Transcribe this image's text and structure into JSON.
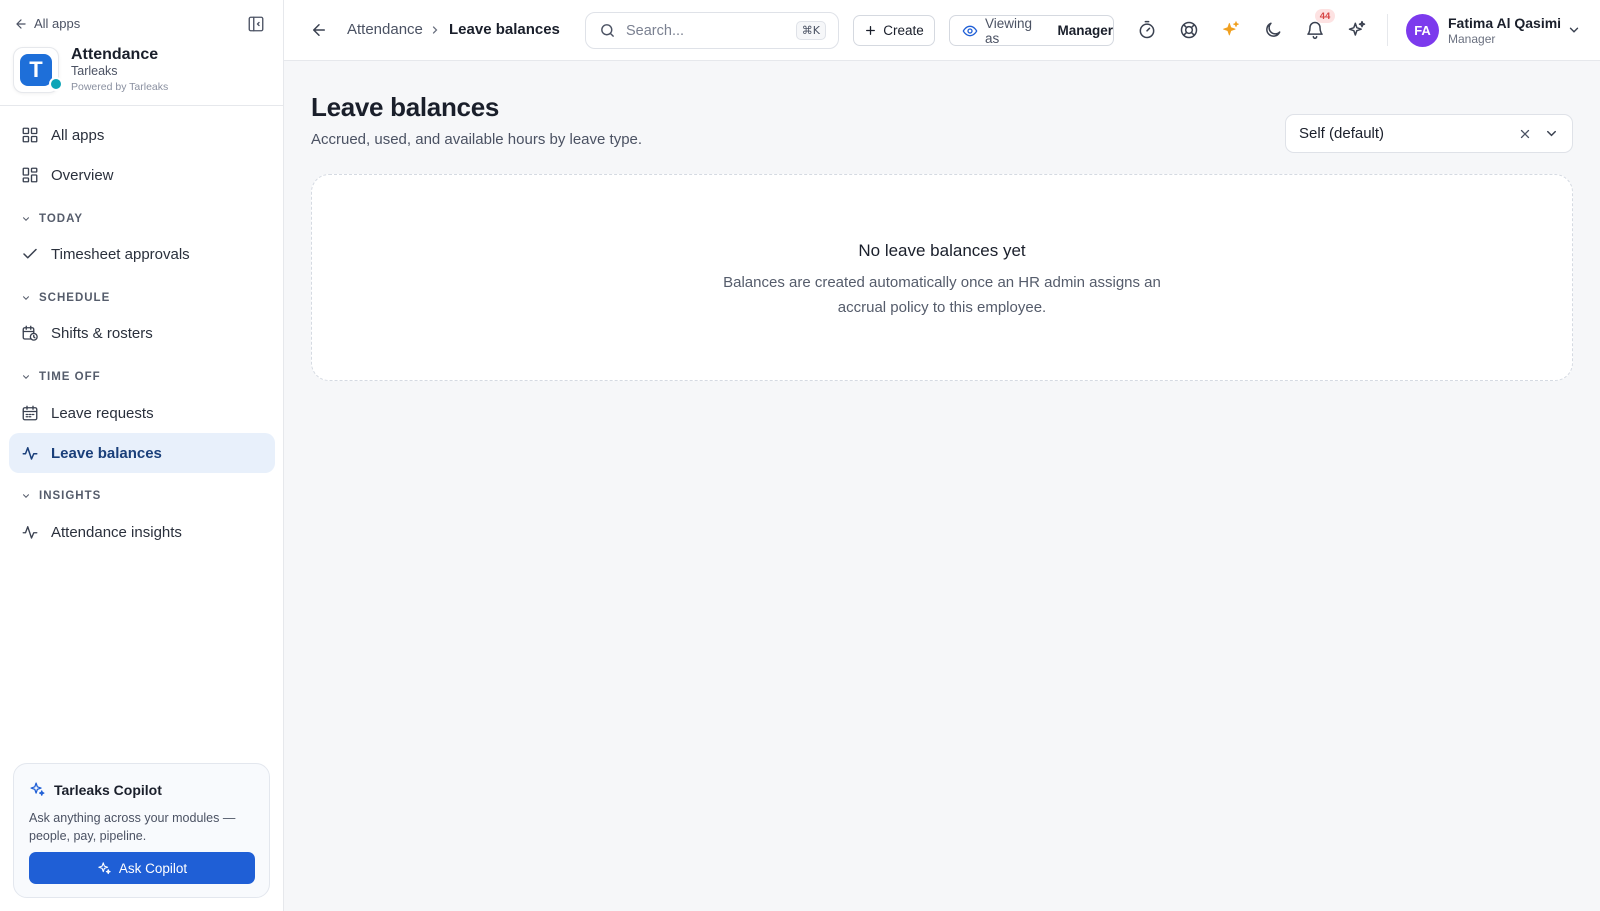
{
  "sidebar": {
    "back_label": "All apps",
    "app": {
      "title": "Attendance",
      "org": "Tarleaks",
      "powered": "Powered by Tarleaks",
      "logo_letter": "T"
    },
    "items": {
      "all_apps": "All apps",
      "overview": "Overview",
      "timesheet_approvals": "Timesheet approvals",
      "shifts_rosters": "Shifts & rosters",
      "leave_requests": "Leave requests",
      "leave_balances": "Leave balances",
      "attendance_insights": "Attendance insights"
    },
    "sections": {
      "today": "TODAY",
      "schedule": "SCHEDULE",
      "time_off": "TIME OFF",
      "insights": "INSIGHTS"
    },
    "active_item": "Leave balances",
    "copilot": {
      "title": "Tarleaks Copilot",
      "description": "Ask anything across your modules — people, pay, pipeline.",
      "button": "Ask Copilot"
    }
  },
  "topbar": {
    "breadcrumb": [
      "Attendance",
      "Leave balances"
    ],
    "search": {
      "placeholder": "Search...",
      "shortcut": "⌘K"
    },
    "create_label": "Create",
    "viewing_as_label": "Viewing as",
    "viewing_as_role": "Manager",
    "notification_count": "44",
    "user": {
      "initials": "FA",
      "name": "Fatima Al Qasimi",
      "role": "Manager"
    }
  },
  "main": {
    "title": "Leave balances",
    "description": "Accrued, used, and available hours by leave type.",
    "scope_select": {
      "value": "Self (default)"
    },
    "empty_state": {
      "title": "No leave balances yet",
      "description": "Balances are created automatically once an HR admin assigns an accrual policy to this employee."
    }
  },
  "colors": {
    "accent": "#1f5fd6",
    "active_nav_bg": "#e8f0fb",
    "avatar": "#7c3aed",
    "sparkle": "#f0a020"
  }
}
